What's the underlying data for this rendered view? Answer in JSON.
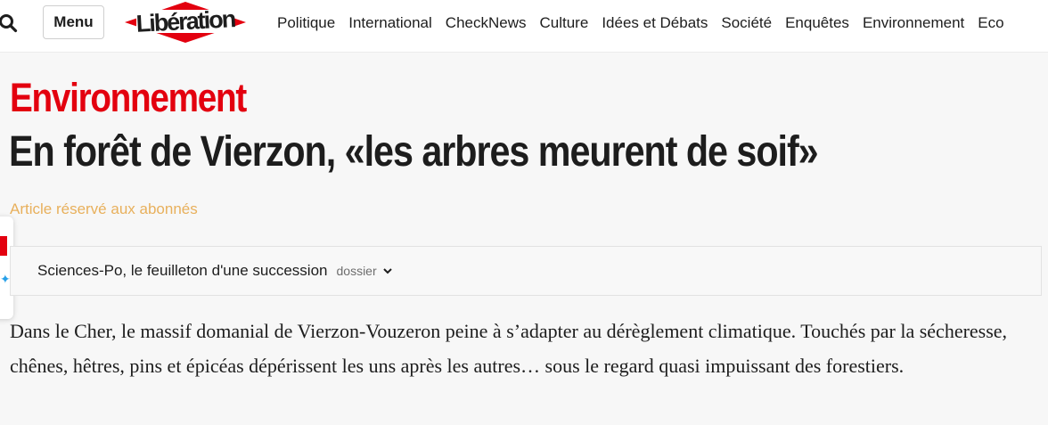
{
  "header": {
    "search_icon": "search-icon",
    "menu_label": "Menu",
    "logo_text": "Libération",
    "nav": [
      "Politique",
      "International",
      "CheckNews",
      "Culture",
      "Idées et Débats",
      "Société",
      "Enquêtes",
      "Environnement",
      "Eco"
    ]
  },
  "article": {
    "kicker": "Environnement",
    "title": "En forêt de Vierzon, «les arbres meurent de soif»",
    "subscriber_note": "Article réservé aux abonnés",
    "dossier": {
      "title": "Sciences-Po, le feuilleton d'une succession",
      "tag": "dossier"
    },
    "lede": "Dans le Cher, le massif domanial de Vierzon-Vouzeron peine à s’adapter au dérèglement climatique. Touchés par la sécheresse, chênes, hêtres, pins et épicéas dépérissent les uns après les autres… sous le regard quasi impuissant des forestiers."
  },
  "colors": {
    "brand_red": "#e3000f",
    "subscriber_gold": "#e8b05c",
    "text": "#1d1d1d"
  }
}
